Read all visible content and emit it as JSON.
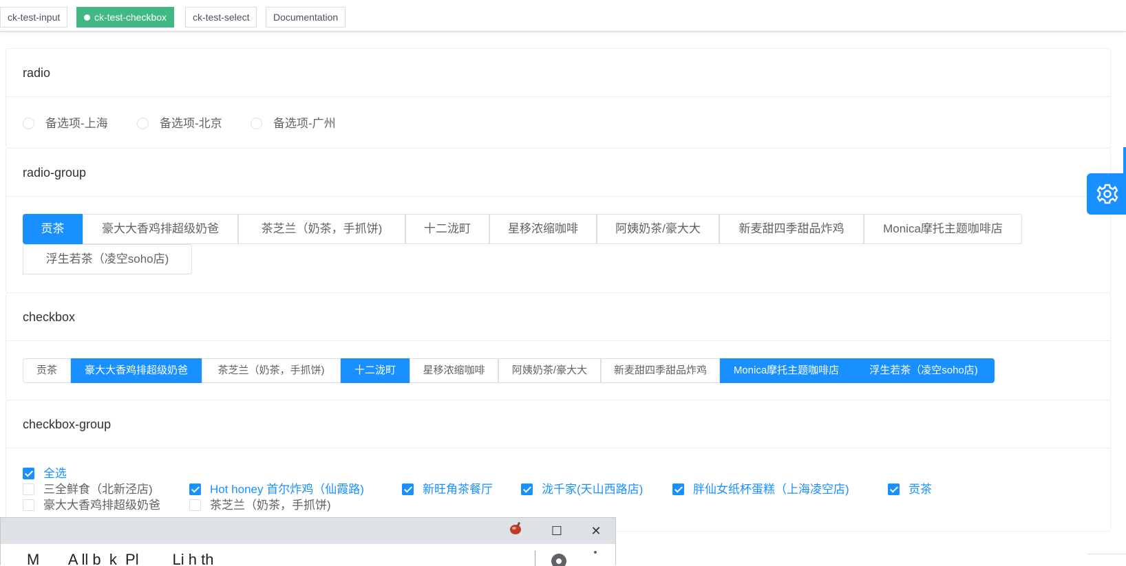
{
  "tags": [
    {
      "label": "ck-test-input",
      "active": false
    },
    {
      "label": "ck-test-checkbox",
      "active": true
    },
    {
      "label": "ck-test-select",
      "active": false
    },
    {
      "label": "Documentation",
      "active": false
    }
  ],
  "radio": {
    "title": "radio",
    "options": [
      "备选项-上海",
      "备选项-北京",
      "备选项-广州"
    ]
  },
  "radio_group": {
    "title": "radio-group",
    "selected": "贡茶",
    "options": [
      "贡茶",
      "豪大大香鸡排超级奶爸",
      "茶芝兰（奶茶，手抓饼)",
      "十二泷町",
      "星移浓缩咖啡",
      "阿姨奶茶/豪大大",
      "新麦甜四季甜品炸鸡",
      "Monica摩托主题咖啡店",
      "浮生若茶（凌空soho店)"
    ]
  },
  "checkbox": {
    "title": "checkbox",
    "options": [
      "贡茶",
      "豪大大香鸡排超级奶爸",
      "茶芝兰（奶茶，手抓饼)",
      "十二泷町",
      "星移浓缩咖啡",
      "阿姨奶茶/豪大大",
      "新麦甜四季甜品炸鸡",
      "Monica摩托主题咖啡店",
      "浮生若茶（凌空soho店)"
    ],
    "checked": [
      "豪大大香鸡排超级奶爸",
      "十二泷町",
      "Monica摩托主题咖啡店",
      "浮生若茶（凌空soho店)"
    ]
  },
  "checkbox_group": {
    "title": "checkbox-group",
    "select_all_label": "全选",
    "items": [
      {
        "label": "三全鲜食（北新泾店)",
        "checked": false
      },
      {
        "label": "Hot honey 首尔炸鸡（仙霞路)",
        "checked": true
      },
      {
        "label": "新旺角茶餐厅",
        "checked": true
      },
      {
        "label": "泷千家(天山西路店)",
        "checked": true
      },
      {
        "label": "胖仙女纸杯蛋糕（上海凌空店)",
        "checked": true
      },
      {
        "label": "贡茶",
        "checked": true
      },
      {
        "label": "豪大大香鸡排超级奶爸",
        "checked": false
      },
      {
        "label": "茶芝兰（奶茶，手抓饼)",
        "checked": false
      }
    ]
  },
  "colors": {
    "primary": "#1890ff",
    "tag_active": "#42b983"
  },
  "icons": {
    "settings": "gear-icon",
    "minimize": "maximize-icon",
    "close": "close-icon"
  },
  "popup": {
    "partial_text": "M       A ll b  k  Pl        Li h th"
  }
}
